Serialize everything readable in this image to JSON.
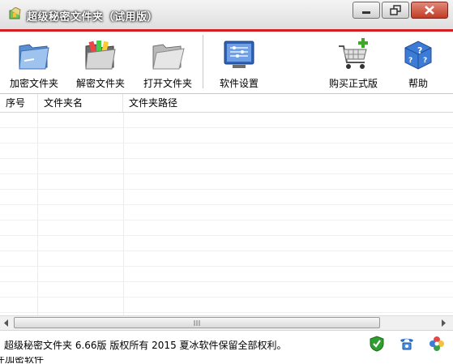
{
  "window": {
    "title": "超级秘密文件夹（试用版）",
    "controls": [
      "minimize",
      "restore",
      "close"
    ]
  },
  "toolbar": {
    "items": [
      {
        "id": "encrypt",
        "label": "加密文件夹",
        "icon": "folder-lock-icon"
      },
      {
        "id": "decrypt",
        "label": "解密文件夹",
        "icon": "folder-unlock-icon"
      },
      {
        "id": "open",
        "label": "打开文件夹",
        "icon": "folder-open-icon"
      },
      {
        "id": "settings",
        "label": "软件设置",
        "icon": "settings-icon"
      },
      {
        "id": "buy",
        "label": "购买正式版",
        "icon": "shopping-cart-icon"
      },
      {
        "id": "help",
        "label": "帮助",
        "icon": "help-icon"
      }
    ]
  },
  "table": {
    "columns": [
      "序号",
      "文件夹名",
      "文件夹路径"
    ],
    "rows": []
  },
  "statusbar": {
    "text": "超级秘密文件夹 6.66版 版权所有 2015 夏冰软件保留全部权利。",
    "icons": [
      "shield-check-icon",
      "telephone-icon",
      "colorful-flower-icon"
    ]
  },
  "below_text": "件加密软件",
  "colors": {
    "accent_red": "#d81e1e",
    "close_button": "#c43b24",
    "shield_green": "#2e9e2e"
  }
}
